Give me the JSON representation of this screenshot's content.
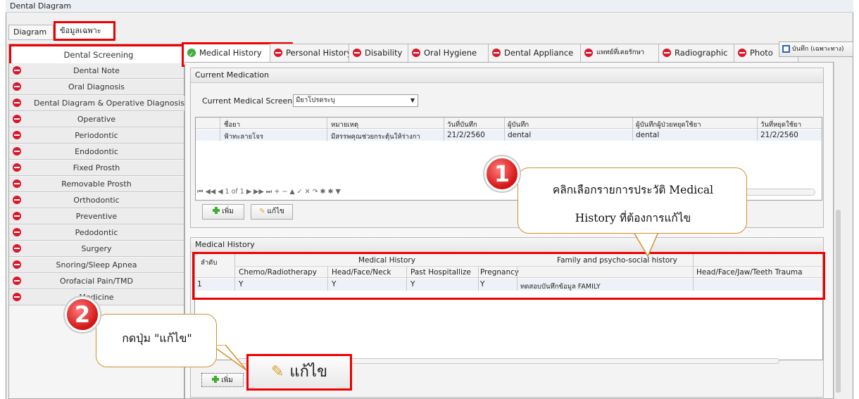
{
  "window": {
    "title": "Dental Diagram"
  },
  "top_tabs": [
    {
      "label": "Diagram"
    },
    {
      "label": "ข้อมูลเฉพาะทาง"
    }
  ],
  "sidebar": {
    "items": [
      {
        "label": "Dental Screening"
      },
      {
        "label": "Dental Note"
      },
      {
        "label": "Oral Diagnosis"
      },
      {
        "label": "Dental Diagram & Operative Diagnosis"
      },
      {
        "label": "Operative"
      },
      {
        "label": "Periodontic"
      },
      {
        "label": "Endodontic"
      },
      {
        "label": "Fixed Prosth"
      },
      {
        "label": "Removable Prosth"
      },
      {
        "label": "Orthodontic"
      },
      {
        "label": "Preventive"
      },
      {
        "label": "Pedodontic"
      },
      {
        "label": "Surgery"
      },
      {
        "label": "Snoring/Sleep Apnea"
      },
      {
        "label": "Orofacial Pain/TMD"
      },
      {
        "label": "Medicine"
      }
    ]
  },
  "tabs": [
    {
      "label": "Medical History"
    },
    {
      "label": "Personal History"
    },
    {
      "label": "Disability"
    },
    {
      "label": "Oral Hygiene"
    },
    {
      "label": "Dental Appliance"
    },
    {
      "label": "แพทย์ที่เคยรักษา"
    },
    {
      "label": "Radiographic"
    },
    {
      "label": "Photo"
    }
  ],
  "save_label": "บันทึก (เฉพาะทาง)",
  "current_medication": {
    "title": "Current Medication",
    "screen_label": "Current Medical Screen",
    "screen_value": "มียาโปรดระบุ",
    "columns": [
      "ชื่อยา",
      "หมายเหตุ",
      "วันที่บันทึก",
      "ผู้บันทึก",
      "ผู้บันทึกผู้ป่วยหยุดใช้ยา",
      "วันที่หยุดใช้ยา"
    ],
    "rows": [
      [
        "ฟ้าทะลายโจร",
        "มีสรรพคุณช่วยกระตุ้นให้ร่างกา",
        "21/2/2560",
        "dental",
        "dental",
        "21/2/2560"
      ]
    ],
    "pager": "1 of 1",
    "add_label": "เพิ่ม",
    "edit_label": "แก้ไข"
  },
  "medical_history": {
    "title": "Medical History",
    "group_headers": {
      "index": "ลำดับ",
      "medical": "Medical History",
      "family": "Family and psycho-social history"
    },
    "columns": [
      "Chemo/Radiotherapy",
      "Head/Face/Neck",
      "Past Hospitallize",
      "Pregnancy",
      "Head/Face/Jaw/Teeth Trauma"
    ],
    "row": {
      "index": "1",
      "chemo": "Y",
      "head": "Y",
      "past": "Y",
      "pregnancy": "Y",
      "family": "ทดสอบบันทึกข้อมูล FAMILY"
    },
    "add_label": "เพิ่ม",
    "edit_label": "แก้ไข"
  },
  "callouts": [
    {
      "number": "1",
      "line1": "คลิกเลือกรายการประวัติ Medical",
      "line2": "History ที่ต้องการแก้ไข"
    },
    {
      "number": "2",
      "text": "กดปุ่ม \"แก้ไข\""
    }
  ],
  "colors": {
    "highlight": "#e00000",
    "minus_icon": "#d8182d",
    "check_icon": "#3cae3c",
    "callout_border": "#d4902a"
  }
}
